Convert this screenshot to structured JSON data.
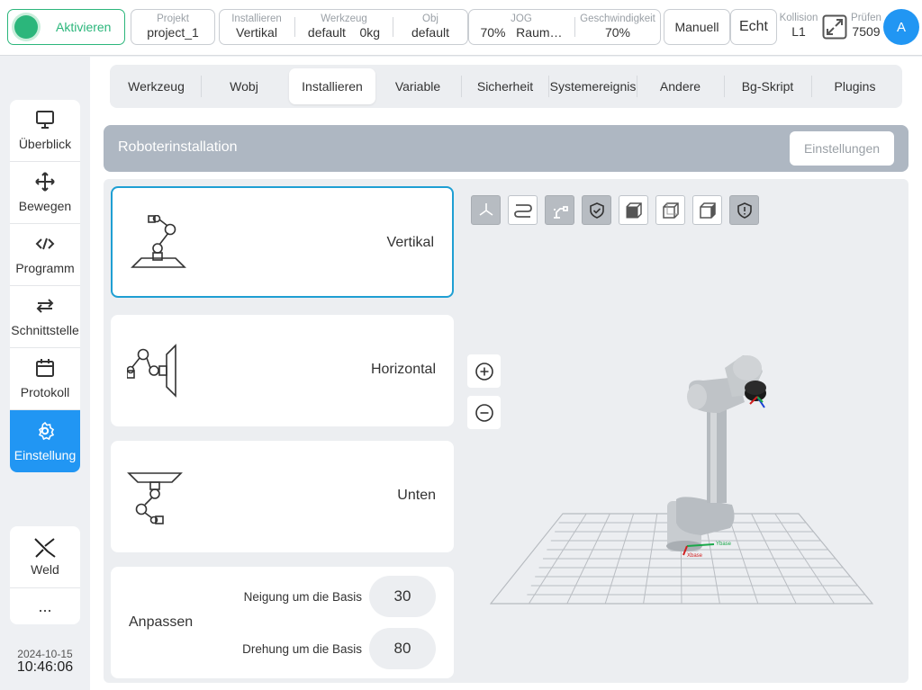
{
  "topbar": {
    "activate_label": "Aktivieren",
    "project_key": "Projekt",
    "project_val": "project_1",
    "install_key": "Installieren",
    "install_val": "Vertikal",
    "tool_key": "Werkzeug",
    "tool_val_name": "default",
    "tool_val_mass": "0kg",
    "obj_key": "Obj",
    "obj_val": "default",
    "jog_key": "JOG",
    "jog_val_pct": "70%",
    "jog_val_mode": "Raum…",
    "speed_key": "Geschwindigkeit",
    "speed_val": "70%",
    "manual_label": "Manuell",
    "real_label": "Echt",
    "collision_key": "Kollision",
    "collision_val": "L1",
    "check_key": "Prüfen",
    "check_val": "7509",
    "avatar_letter": "A",
    "accent": "#2bb67b"
  },
  "sidebar": {
    "items": [
      {
        "label": "Überblick",
        "icon": "monitor-icon"
      },
      {
        "label": "Bewegen",
        "icon": "move-icon"
      },
      {
        "label": "Programm",
        "icon": "code-icon"
      },
      {
        "label": "Schnittstelle",
        "icon": "exchange-icon"
      },
      {
        "label": "Protokoll",
        "icon": "calendar-icon"
      },
      {
        "label": "Einstellung",
        "icon": "gear-icon",
        "active": true
      }
    ],
    "weld_label": "Weld",
    "more_label": "...",
    "date": "2024-10-15",
    "time": "10:46:06",
    "active_color": "#2196f3"
  },
  "tabs": [
    {
      "label": "Werkzeug"
    },
    {
      "label": "Wobj"
    },
    {
      "label": "Installieren",
      "active": true
    },
    {
      "label": "Variable"
    },
    {
      "label": "Sicherheit"
    },
    {
      "label": "Systemereignis"
    },
    {
      "label": "Andere"
    },
    {
      "label": "Bg-Skript"
    },
    {
      "label": "Plugins"
    }
  ],
  "install": {
    "title": "Roboterinstallation",
    "settings_button": "Einstellungen",
    "options": [
      {
        "label": "Vertikal",
        "selected": true
      },
      {
        "label": "Horizontal"
      },
      {
        "label": "Unten"
      }
    ],
    "adjust": {
      "label": "Anpassen",
      "tilt_label": "Neigung um die Basis",
      "tilt_value": "30",
      "rotation_label": "Drehung um die Basis",
      "rotation_value": "80"
    }
  },
  "viewer": {
    "toolbar": [
      "axes-icon",
      "path-icon",
      "robot-icon",
      "shield-check-icon",
      "cube-front-icon",
      "cube-iso-icon",
      "cube-side-icon",
      "shield-alert-icon"
    ],
    "x_axis_label": "Xbase",
    "y_axis_label": "Ybase"
  }
}
